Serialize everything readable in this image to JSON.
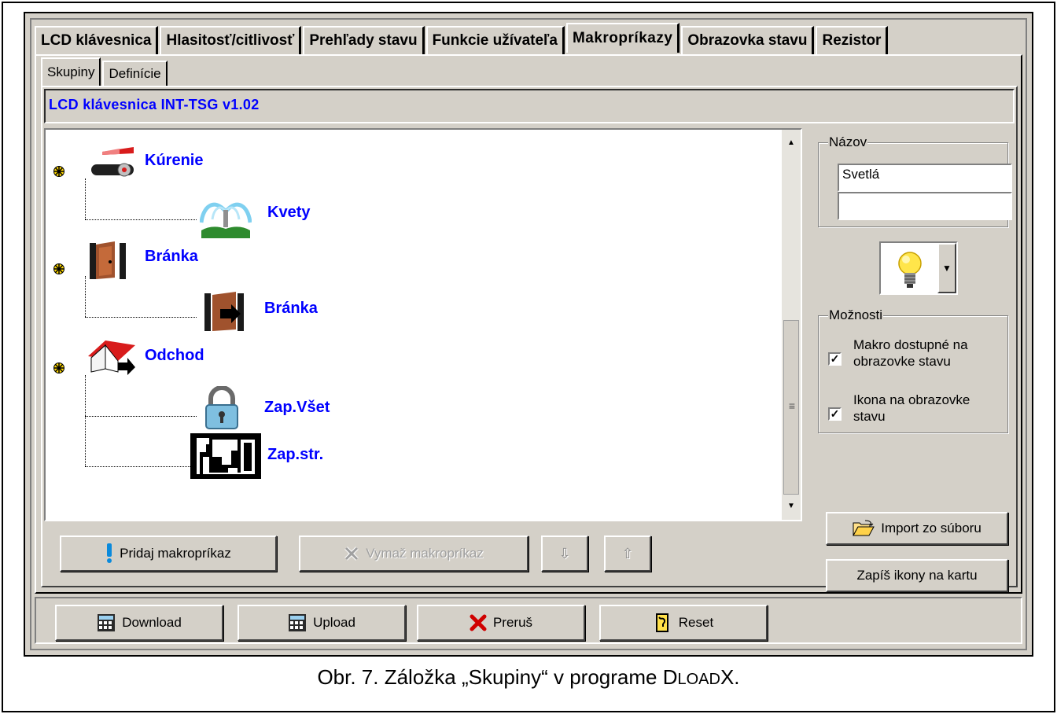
{
  "tabs": [
    {
      "label": "LCD klávesnica",
      "active": false
    },
    {
      "label": "Hlasitosť/citlivosť",
      "active": false
    },
    {
      "label": "Prehľady stavu",
      "active": false
    },
    {
      "label": "Funkcie užívateľa",
      "active": false
    },
    {
      "label": "Makropríkazy",
      "active": true
    },
    {
      "label": "Obrazovka stavu",
      "active": false
    },
    {
      "label": "Rezistor",
      "active": false
    }
  ],
  "subtabs": [
    {
      "label": "Skupiny",
      "active": true
    },
    {
      "label": "Definície",
      "active": false
    }
  ],
  "device_title": "LCD klávesnica INT-TSG v1.02",
  "tree": [
    {
      "label": "Kúrenie",
      "icon": "heating-icon",
      "children": [
        {
          "label": "Kvety",
          "icon": "sprinkler-icon"
        }
      ]
    },
    {
      "label": "Bránka",
      "icon": "door-icon",
      "children": [
        {
          "label": "Bránka",
          "icon": "door-exit-icon"
        }
      ]
    },
    {
      "label": "Odchod",
      "icon": "house-exit-icon",
      "children": [
        {
          "label": "Zap.Všet",
          "icon": "padlock-icon"
        },
        {
          "label": "Zap.str.",
          "icon": "floorplan-icon"
        }
      ]
    }
  ],
  "name_group": {
    "label": "Názov",
    "line1": "Svetlá",
    "line2": ""
  },
  "selected_icon": "lightbulb-icon",
  "options_group": {
    "label": "Možnosti",
    "items": [
      {
        "line1": "Makro dostupné na",
        "line2": "obrazovke stavu",
        "checked": true
      },
      {
        "line1": "Ikona na obrazovke",
        "line2": "stavu",
        "checked": true
      }
    ]
  },
  "buttons": {
    "add": "Pridaj makropríkaz",
    "delete": "Vymaž makropríkaz",
    "import": "Import zo súboru",
    "write_icons": "Zapíš ikony na kartu",
    "download": "Download",
    "upload": "Upload",
    "abort": "Preruš",
    "reset": "Reset"
  },
  "caption": {
    "prefix": "Obr. 7. Záložka „Skupiny“ v programe D",
    "smallcaps": "LOAD",
    "suffix": "X."
  }
}
